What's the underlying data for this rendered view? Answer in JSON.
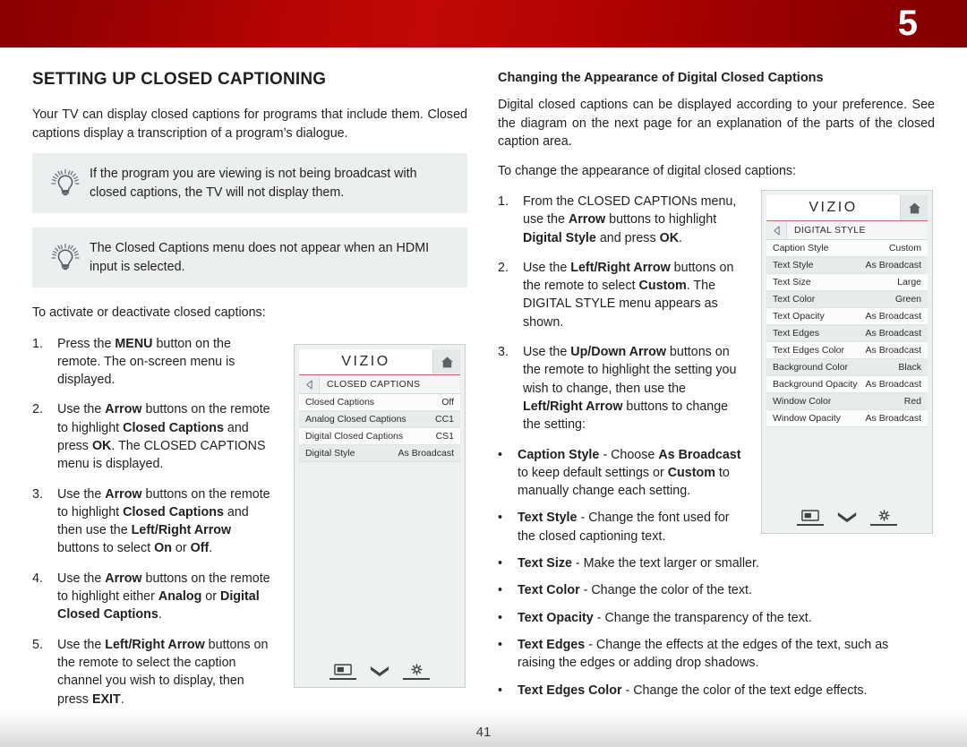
{
  "header": {
    "chapter_number": "5",
    "accent_color": "#b70404",
    "accent_color_dark": "#8a0000"
  },
  "left_column": {
    "title": "SETTING UP CLOSED CAPTIONING",
    "intro": "Your TV can display closed captions for programs that include them. Closed captions display a transcription of a program’s dialogue.",
    "tips": [
      {
        "icon": "lightbulb-icon",
        "text": "If the program you are viewing is not being broadcast with closed captions, the TV will not display them."
      },
      {
        "icon": "lightbulb-icon",
        "text": "The Closed Captions menu does not appear when an HDMI input is selected."
      }
    ],
    "lead_in": "To activate or deactivate closed captions:",
    "steps": [
      {
        "num": "1.",
        "html": "Press the <b>MENU</b> button on the remote. The on-screen menu is displayed."
      },
      {
        "num": "2.",
        "html": "Use the <b>Arrow</b> buttons on the remote to highlight <b>Closed Captions</b> and press <b>OK</b>. The CLOSED CAPTIONS menu is displayed."
      },
      {
        "num": "3.",
        "html": "Use the <b>Arrow</b> buttons on the remote to highlight <b>Closed Captions</b> and then use the <b>Left/Right Arrow</b> buttons to select <b>On</b> or <b>Off</b>."
      },
      {
        "num": "4.",
        "html": "Use the <b>Arrow</b> buttons on the remote to highlight either <b>Analog</b> or <b>Digital Closed Captions</b>."
      },
      {
        "num": "5.",
        "html": "Use the <b>Left/Right Arrow</b> buttons on the remote to select the caption channel you wish to display, then press <b>EXIT</b>."
      }
    ]
  },
  "right_column": {
    "title": "Changing the Appearance of Digital Closed Captions",
    "intro": "Digital closed captions can be displayed according to your preference. See the diagram on the next page for an explanation of the parts of the closed caption area.",
    "lead_in": "To change the appearance of digital closed captions:",
    "steps": [
      {
        "num": "1.",
        "html": "From the CLOSED CAPTIONs menu, use the <b>Arrow</b> buttons to highlight <b>Digital Style</b> and press <b>OK</b>."
      },
      {
        "num": "2.",
        "html": "Use the <b>Left/Right Arrow</b> buttons on the remote to select <b>Custom</b>. The DIGITAL STYLE menu appears as shown."
      },
      {
        "num": "3.",
        "html": "Use the <b>Up/Down Arrow</b> buttons on the remote to highlight the setting you wish to change, then use the <b>Left/Right Arrow</b> buttons to change the setting:"
      }
    ],
    "bullets": [
      {
        "dot": "•",
        "html": "<b>Caption Style</b> - Choose <b>As Broadcast</b> to keep default settings or <b>Custom</b> to manually change each setting."
      },
      {
        "dot": "•",
        "html": "<b>Text Style</b>  - Change the font used for the closed captioning text."
      },
      {
        "dot": "•",
        "html": "<b>Text Size</b> - Make the text larger or smaller."
      },
      {
        "dot": "•",
        "html": "<b>Text Color</b> - Change the color of the text."
      },
      {
        "dot": "•",
        "html": "<b>Text Opacity</b> - Change the transparency of the text."
      },
      {
        "dot": "•",
        "html": "<b>Text Edges</b> - Change the effects at the edges of the text, such as raising the edges or adding drop shadows."
      },
      {
        "dot": "•",
        "html": "<b>Text Edges Color</b> - Change the color of the text edge effects."
      }
    ]
  },
  "menu_closed_captions": {
    "brand": "VIZIO",
    "home_icon": "home-icon",
    "back_icon": "back-arrow-icon",
    "breadcrumb": "CLOSED CAPTIONS",
    "rows": [
      {
        "label": "Closed Captions",
        "value": "Off"
      },
      {
        "label": "Analog Closed Captions",
        "value": "CC1"
      },
      {
        "label": "Digital Closed Captions",
        "value": "CS1"
      },
      {
        "label": "Digital Style",
        "value": "As Broadcast"
      }
    ],
    "footer_icons": [
      "picture-icon",
      "chevron-double-down-icon",
      "gear-icon"
    ]
  },
  "menu_digital_style": {
    "brand": "VIZIO",
    "home_icon": "home-icon",
    "back_icon": "back-arrow-icon",
    "breadcrumb": "DIGITAL STYLE",
    "rows": [
      {
        "label": "Caption Style",
        "value": "Custom"
      },
      {
        "label": "Text Style",
        "value": "As Broadcast"
      },
      {
        "label": "Text Size",
        "value": "Large"
      },
      {
        "label": "Text Color",
        "value": "Green"
      },
      {
        "label": "Text Opacity",
        "value": "As Broadcast"
      },
      {
        "label": "Text Edges",
        "value": "As Broadcast"
      },
      {
        "label": "Text Edges Color",
        "value": "As Broadcast"
      },
      {
        "label": "Background Color",
        "value": "Black"
      },
      {
        "label": "Background Opacity",
        "value": "As Broadcast"
      },
      {
        "label": "Window Color",
        "value": "Red"
      },
      {
        "label": "Window Opacity",
        "value": "As Broadcast"
      }
    ],
    "footer_icons": [
      "picture-icon",
      "chevron-double-down-icon",
      "gear-icon"
    ]
  },
  "footer": {
    "page_number": "41"
  }
}
